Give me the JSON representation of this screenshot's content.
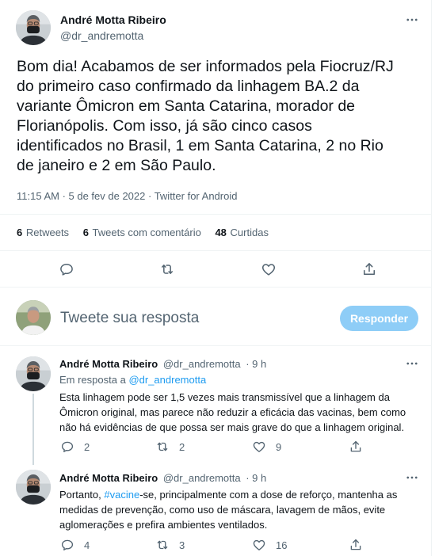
{
  "main_tweet": {
    "author_name": "André Motta Ribeiro",
    "author_handle": "@dr_andremotta",
    "text_lines": [
      "Bom dia! Acabamos de ser informados pela Fiocruz/RJ",
      "do primeiro caso confirmado da linhagem BA.2 da",
      "variante Ômicron em Santa Catarina, morador de",
      "Florianópolis. Com isso, já são cinco casos",
      "identificados no Brasil, 1 em Santa Catarina, 2 no Rio",
      "de janeiro e 2 em São Paulo."
    ],
    "meta": "11:15 AM · 5 de fev de 2022 · Twitter for Android",
    "stats": {
      "retweets_count": "6",
      "retweets_label": "Retweets",
      "quotes_count": "6",
      "quotes_label": "Tweets com comentário",
      "likes_count": "48",
      "likes_label": "Curtidas"
    }
  },
  "reply_box": {
    "placeholder": "Tweete sua resposta",
    "button_label": "Responder"
  },
  "replies": [
    {
      "author_name": "André Motta Ribeiro",
      "author_handle": "@dr_andremotta",
      "time": "· 9 h",
      "replying_prefix": "Em resposta a ",
      "replying_to": "@dr_andremotta",
      "text_lines": [
        "Esta linhagem pode ser 1,5 vezes mais transmissível que a linhagem da",
        "Ômicron original, mas parece não reduzir a eficácia das vacinas, bem como",
        "não há evidências de que possa ser mais grave do que a linhagem original."
      ],
      "reply_count": "2",
      "retweet_count": "2",
      "like_count": "9"
    },
    {
      "author_name": "André Motta Ribeiro",
      "author_handle": "@dr_andremotta",
      "time": "· 9 h",
      "text_line1_prefix": "Portanto, ",
      "hashtag": "#vacine",
      "text_line1_suffix": "-se, principalmente com a dose de reforço, mantenha as",
      "text_lines_rest": [
        "medidas de prevenção, como uso de máscara, lavagem de mãos, evite",
        "aglomerações e prefira ambientes ventilados."
      ],
      "reply_count": "4",
      "retweet_count": "3",
      "like_count": "16"
    }
  ],
  "colors": {
    "accent": "#1d9bf0",
    "button_disabled": "#8ecdf7",
    "muted_text": "#536471",
    "divider": "#eff3f4"
  }
}
